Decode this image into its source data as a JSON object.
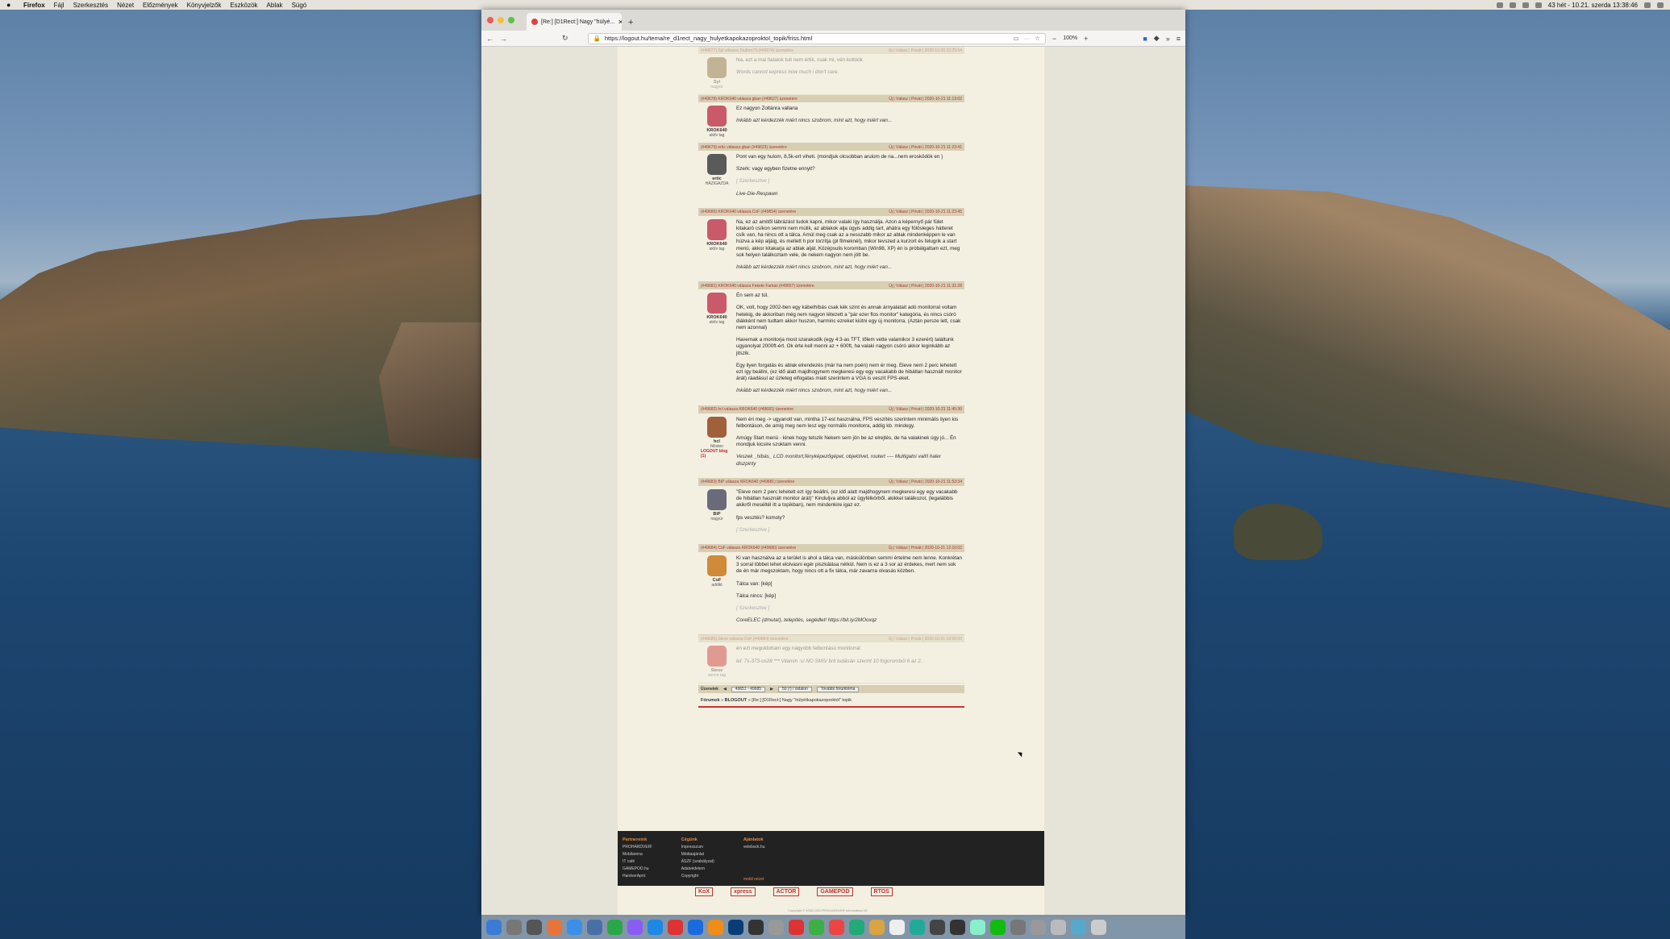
{
  "menubar": {
    "app": "Firefox",
    "items": [
      "Fájl",
      "Szerkesztés",
      "Nézet",
      "Előzmények",
      "Könyvjelzők",
      "Eszközök",
      "Ablak",
      "Súgó"
    ],
    "clock": "43 hét - 10.21. szerda  13:38:46"
  },
  "browser": {
    "tab_title": "[Re:] [D1Rect:] Nagy \"hülyé...",
    "url": "https://logout.hu/tema/re_d1rect_nagy_hulyetkapokazoproktol_topik/friss.html",
    "zoom": "100%"
  },
  "posts": [
    {
      "head_left": "(#49677) Syl válasza Toulbro73 (#49674) üzenetére",
      "head_right": "Új | Válasz | Privát | 2020-10-20 22:29:54",
      "name": "Syl",
      "rank": "nagyúr",
      "avatar_color": "#8a6a3a",
      "faded": true,
      "paras": [
        "Na, ezt a mai fiatalok tuti nem értik, csak mi, vén kotlóók"
      ],
      "sig": "Words cannot express how much i don't care."
    },
    {
      "head_left": "(#49678) KROK640 válasza gban (#49627) üzenetére",
      "head_right": "Új | Válasz | Privát | 2020-10-21 11:13:02",
      "name": "KROK640",
      "rank": "aktív tag",
      "avatar_color": "#c95a6a",
      "faded": false,
      "paras": [
        "Ez nagyon Zoltánra vallana"
      ],
      "sig": "Inkább azt kérdezzék miért nincs szobrom, mint azt, hogy miért van..."
    },
    {
      "head_left": "(#49679) ertic válasza gban (#49623) üzenetére",
      "head_right": "Új | Válasz | Privát | 2020-10-21 11:23:41",
      "name": "ertic",
      "rank": "HÁZIGAZDA",
      "avatar_color": "#5a5a5a",
      "faded": false,
      "paras": [
        "Pont van egy hulom, 8,5k-ert viheti. (mondjuk olcsobban arulom de na...nem erosködök en )",
        "Szerk: vagy egyben fizetne ennyit?"
      ],
      "edit": "[ Szerkesztve ]",
      "sig": "Live-Die-Respawn"
    },
    {
      "head_left": "(#49680) KROK640 válasza CoF (#49654) üzenetére",
      "head_right": "Új | Válasz | Privát | 2020-10-21 11:23:45",
      "name": "KROK640",
      "rank": "aktív tag",
      "avatar_color": "#c95a6a",
      "faded": false,
      "paras": [
        "Na, ez az amitől lábrázást tudok kapni, mikor valaki így használja. Azon a képernyő pár fület kitakaró csíkon semmi nem múlik, az ablakok alja úgyis addig tart, ahátra egy fölösleges hátteret csík van, ha nincs ott a tálca. Amúl meg csak az a nesszabb mikor az ablak mindenképpen le van húzva a kép aljáig, és mellett h por torzítja (pl filmeknél), mikor tevszed a kurzort és felugrik a start menü, akkor kitakarja az ablak alját. Középsulis koromban (Win98, XP) én is próbálgattam ezt, meg sok helyen találkoztam vele, de nekem nagyon nem jött be."
      ],
      "sig": "Inkább azt kérdezzék miért nincs szobrom, mint azt, hogy miért van..."
    },
    {
      "head_left": "(#49681) KROK640 válasza Fekete Farkas (#49657) üzenetére",
      "head_right": "Új | Válasz | Privát | 2020-10-21 11:31:28",
      "name": "KROK640",
      "rank": "aktív tag",
      "avatar_color": "#c95a6a",
      "faded": false,
      "paras": [
        "Én sem az túl.",
        "OK, volt, hogy 2002-ben egy kábelhíbás csak kék szint és annak árnyalatait adó monitorral voltam hetekig, de akkoriban még nem nagyon létezett a \"pár ezer flos monitor\" kategória, és nincs csóró diákként nem tudtam akkor huszon, harminc ezreket kiütni egy új monitorra. (Aztán persze lett, csak nem azonnal)",
        "Havernak a monitorja most szarakodik (egy 4:3-as TFT, tőlem vette valamikor 3 ezerért) találtunk ugyanolyat 2000ft-ért. Ok érte kell menni az + 600ft, ha valaki nagyon csóró akkor leginkább az jitszik.",
        "Egy ilyen forgatás és ablak elrendezés (már ha nem poén) nem ér meg. Eleve nem 2 perc lehetett ezt így beállni, (ez idő alatt majdhogynem megkeresi egy egy vacakabb de hibátlan használt monitor árát) ráadásul az üzleteg elfogatas miatt szerintem a VGA is veszít FPS-eket."
      ],
      "sig": "Inkább azt kérdezzék miért nincs szobrom, mint azt, hogy miért van..."
    },
    {
      "head_left": "(#49682) hcl válasza KROK640 (#49681) üzenetére",
      "head_right": "Új | Válasz | Privát | 2020-10-21 11:45:30",
      "name": "hcl",
      "rank": "félisten",
      "logout": "LOGOUT blog (1)",
      "avatar_color": "#a0603a",
      "faded": false,
      "paras": [
        "Nem éri meg -> ugyanott van, mintha 17-est használna, FPS veszítés szerintem minimális ilyen kis felbontáson, de amíg meg nem lesz egy normális monitorra, addig kb. mindegy.",
        "Amúgy Start menü - kinek hogy tetszik Nekem sem jön be az elrejtés, de ha valakinek úgy jó... Én mondjuk kicsire szoktam venni."
      ],
      "sig": "Veszek _hibás_ LCD monitort,fényképezőgépet, objektívet, routert ---- Multigatni vall!i haler diszpinty"
    },
    {
      "head_left": "(#49683) BiP válasza KROK640 (#49681) üzenetére",
      "head_right": "Új | Válasz | Privát | 2020-10-21 11:53:34",
      "name": "BiP",
      "rank": "nagyúr",
      "avatar_color": "#6a6a7a",
      "faded": false,
      "paras": [
        "\"Eleve nem 2 perc lehetett ezt így beállni, (ez idő alatt majdhogynem megkeresi egy egy vacakabb de hibátlan használt monitor árát)\" Kinduljva abból az ügyfélkörből, akikkel találkozol, (legalábbis akikről meséltél itt a topikban), nem mindenkire igaz ez.",
        "fps vesztés? komoly?"
      ],
      "edit": "[ Szerkesztve ]"
    },
    {
      "head_left": "(#49684) CoF válasza KROK640 (#49680) üzenetére",
      "head_right": "Új | Válasz | Privát | 2020-10-21 12:10:02",
      "name": "CoF",
      "rank": "addikt",
      "avatar_color": "#d08a3a",
      "faded": false,
      "paras": [
        "Ki van használva az a terület is ahol a tálca van, máskülönben semmi értelme nem lenne. Konkrétan 3 sorral többet lehet elolvasni egér piszkálása nélkül. Nem is ez a 3 sor az érdekes, mert nem sok de én már megszoktam, hogy nincs ott a fix tálca, már zavarna olvasás közben.",
        "Tálca van: [kép]",
        "Tálca nincs: [kép]"
      ],
      "edit": "[ Szerkesztve ]",
      "sig": "CoreELEC (drnuta!), telepítés, segédlet! https://bit.ly/2MOoxqz"
    },
    {
      "head_left": "(#49685) Steve válasza CoF (#49684) üzenetére",
      "head_right": "Új | Válasz | Privát | 2020-10-21 12:26:03",
      "name": "Steve",
      "rank": "senior tag",
      "avatar_color": "#c33",
      "faded": true,
      "paras": [
        "én ezt megoldottam egy nagyobb felbontású monitorral"
      ],
      "sig": "lel: 7s-373-os28 *** Vilamin :s/ NO SMS/ brit tudásán szerint 10 fogoromból 6 az 2."
    }
  ],
  "pager": {
    "label": "Üzenetek",
    "range": "49651 - 49685",
    "per_page": "50 (!) / oldalon",
    "more": "További fórumtéma"
  },
  "breadcrumb": {
    "forum": "Fórumok",
    "blog": "BLOGOUT",
    "topic": "[Re:] [D1Rect:] Nagy \"hülyétkapokazoproktól\" topik"
  },
  "footer": {
    "col1_title": "Partnereink",
    "col1": [
      "PROHARDVER!",
      "Mobilarena",
      "IT café",
      "GAMEPOD.hu",
      "HardverApró"
    ],
    "col2_title": "Cégünk",
    "col2": [
      "Impresszum",
      "Médiaajánlat",
      "ÁSZF (szabályzat)",
      "Adatvédelem",
      "Copyright"
    ],
    "col3_title": "Ajánlatok",
    "col3": [
      "velebock.hu"
    ],
    "col3_link": "mobil nézet"
  },
  "partners": [
    "KoX",
    "xpress",
    "ACTOR",
    "GAMEPOD",
    "RTOS"
  ],
  "copyright": "Copyright © 2000-2020 PROHARDVER Informatikai Kft."
}
